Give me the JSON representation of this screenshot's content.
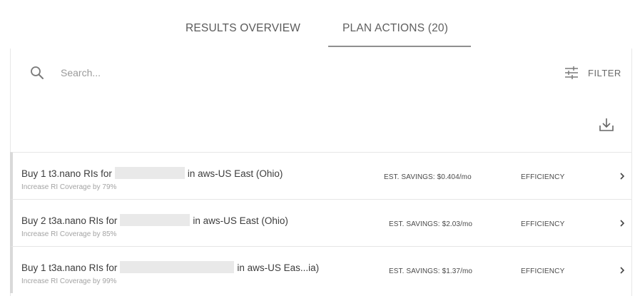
{
  "tabs": {
    "results_label": "RESULTS OVERVIEW",
    "plan_label": "PLAN ACTIONS (20)"
  },
  "search": {
    "placeholder": "Search..."
  },
  "toolbar": {
    "filter_label": "FILTER",
    "filter_icon": "sliders-icon",
    "download_icon": "download-icon"
  },
  "actions": [
    {
      "title_prefix": "Buy 1 t3.nano RIs for",
      "title_suffix": "in aws-US East (Ohio)",
      "subtitle": "Increase RI Coverage by 79%",
      "savings": "EST. SAVINGS: $0.404/mo",
      "category": "EFFICIENCY"
    },
    {
      "title_prefix": "Buy 2 t3a.nano RIs for",
      "title_suffix": "in aws-US East (Ohio)",
      "subtitle": "Increase RI Coverage by 85%",
      "savings": "EST. SAVINGS: $2.03/mo",
      "category": "EFFICIENCY"
    },
    {
      "title_prefix": "Buy 1 t3a.nano RIs for",
      "title_suffix": "in aws-US Eas...ia)",
      "subtitle": "Increase RI Coverage by 99%",
      "savings": "EST. SAVINGS: $1.37/mo",
      "category": "EFFICIENCY"
    }
  ]
}
